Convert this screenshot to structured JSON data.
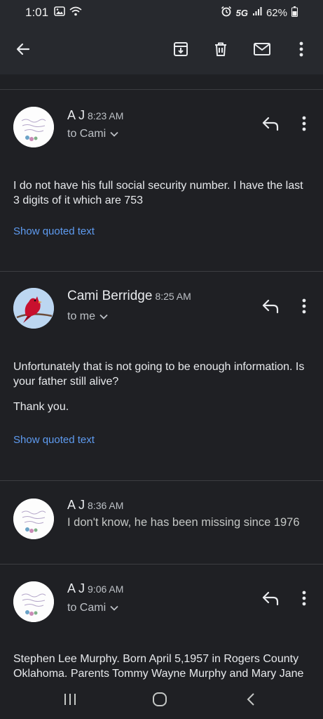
{
  "status_bar": {
    "time": "1:01",
    "network": "5G",
    "battery": "62%",
    "icons": [
      "gallery-icon",
      "wifi-icon",
      "alarm-icon",
      "signal-icon",
      "battery-icon"
    ]
  },
  "toolbar": {
    "icons": [
      "back-arrow-icon",
      "archive-icon",
      "delete-icon",
      "mark-unread-icon",
      "more-vert-icon"
    ]
  },
  "messages": [
    {
      "sender": "A J",
      "time": "8:23 AM",
      "recipient": "to Cami",
      "body": [
        "I do not have his full social security number.  I have the last 3 digits of it which are 753"
      ],
      "quoted_link": "Show quoted text"
    },
    {
      "sender": "Cami Berridge",
      "time": "8:25 AM",
      "recipient": "to me",
      "body": [
        "Unfortunately that is not going to be enough information. Is your father still alive?",
        "Thank you."
      ],
      "quoted_link": "Show quoted text"
    },
    {
      "sender": "A J",
      "time": "8:36 AM",
      "snippet": "I don't know, he has been missing since 1976"
    },
    {
      "sender": "A J",
      "time": "9:06 AM",
      "recipient": "to Cami",
      "body": [
        "Stephen Lee Murphy. Born April 5,1957 in Rogers County Oklahoma. Parents Tommy Wayne Murphy and Mary Jane"
      ]
    }
  ],
  "colors": {
    "background": "#1f2024",
    "toolbar": "#27292e",
    "link": "#5e9bf0",
    "text": "#e8eaed",
    "secondary_text": "#bdc1c6"
  },
  "nav_bar": {
    "icons": [
      "recents-icon",
      "home-icon",
      "back-icon"
    ]
  }
}
